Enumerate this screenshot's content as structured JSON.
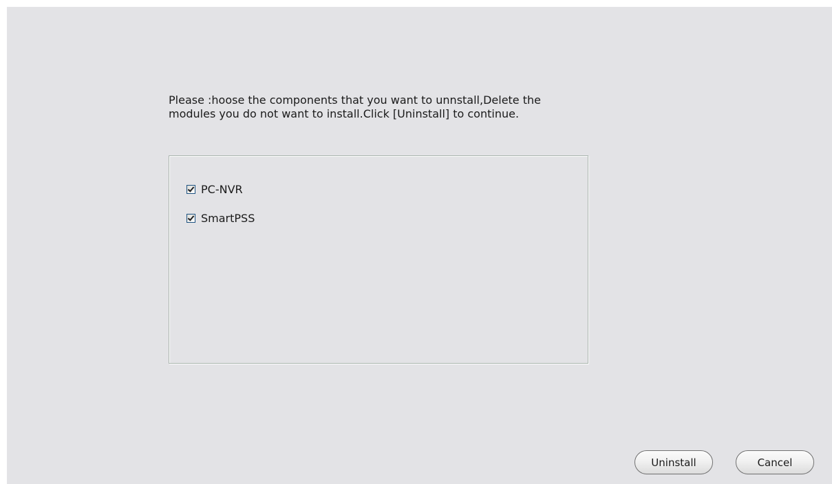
{
  "dialog": {
    "instruction_line1": "Please :hoose the components that you want to unnstall,Delete the",
    "instruction_line2": "modules you do not want to install.Click [Uninstall] to continue."
  },
  "components": [
    {
      "label": "PC-NVR",
      "checked": true
    },
    {
      "label": "SmartPSS",
      "checked": true
    }
  ],
  "buttons": {
    "uninstall_label": "Uninstall",
    "cancel_label": "Cancel"
  },
  "colors": {
    "background": "#e3e3e6",
    "box_border": "#a9b4ad"
  }
}
